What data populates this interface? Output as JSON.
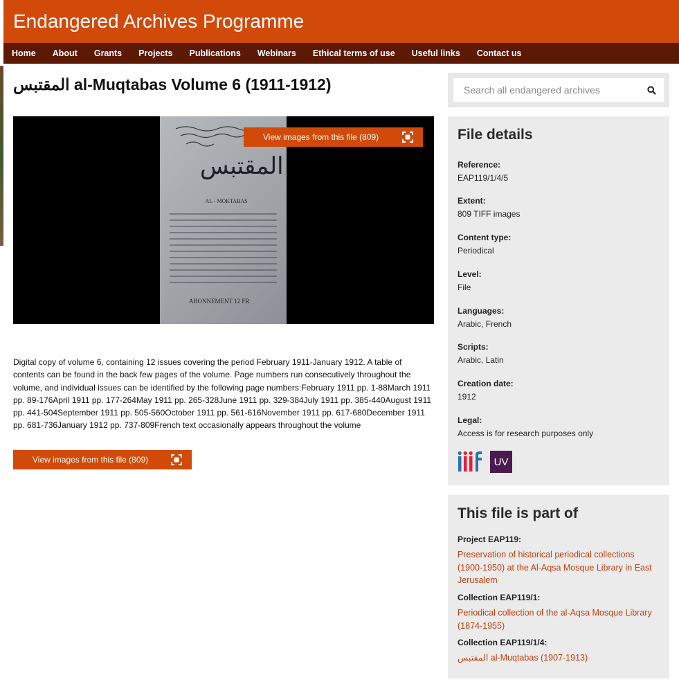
{
  "site": {
    "title": "Endangered Archives Programme"
  },
  "nav": [
    "Home",
    "About",
    "Grants",
    "Projects",
    "Publications",
    "Webinars",
    "Ethical terms of use",
    "Useful links",
    "Contact us"
  ],
  "page": {
    "title": "المقتبس al-Muqtabas Volume 6 (1911-1912)",
    "view_button": "View images from this file (809)",
    "description": "Digital copy of volume 6, containing 12 issues covering the period February 1911-January 1912. A table of contents can be found in the back few pages of the volume. Page numbers run consecutively throughout the volume, and individual issues can be identified by the following page numbers:February 1911 pp. 1-88March 1911 pp. 89-176April 1911 pp. 177-264May 1911 pp. 265-328June 1911 pp. 329-384July 1911 pp. 385-440August 1911 pp. 441-504September 1911 pp. 505-560October 1911 pp. 561-616November 1911 pp. 617-680December 1911 pp. 681-736January 1912 pp. 737-809French text occasionally appears throughout the volume"
  },
  "scan": {
    "title_ar": "المقتبس",
    "title_lat": "AL - MOKTABAS",
    "abonnement": "ABONNEMENT 12 FR"
  },
  "search": {
    "placeholder": "Search all endangered archives"
  },
  "file_details": {
    "heading": "File details",
    "fields": [
      {
        "label": "Reference:",
        "value": "EAP119/1/4/5"
      },
      {
        "label": "Extent:",
        "value": "809 TIFF images"
      },
      {
        "label": "Content type:",
        "value": "Periodical"
      },
      {
        "label": "Level:",
        "value": "File"
      },
      {
        "label": "Languages:",
        "value": "Arabic, French"
      },
      {
        "label": "Scripts:",
        "value": "Arabic, Latin"
      },
      {
        "label": "Creation date:",
        "value": "1912"
      },
      {
        "label": "Legal:",
        "value": "Access is for research purposes only"
      }
    ],
    "logos": {
      "iiif": "iiif",
      "uv": "UV"
    }
  },
  "part_of": {
    "heading": "This file is part of",
    "items": [
      {
        "label": "Project EAP119:",
        "link": "Preservation of historical periodical collections (1900-1950) at the Al-Aqsa Mosque Library in East Jerusalem"
      },
      {
        "label": "Collection EAP119/1:",
        "link": "Periodical collection of the al-Aqsa Mosque Library (1874-1955)"
      },
      {
        "label": "Collection EAP119/1/4:",
        "link": "المقتبس al-Muqtabas (1907-1913)"
      }
    ]
  },
  "colors": {
    "brand": "#d14a09",
    "nav": "#5c1906",
    "link": "#c63d0a",
    "panel": "#ebebeb"
  }
}
